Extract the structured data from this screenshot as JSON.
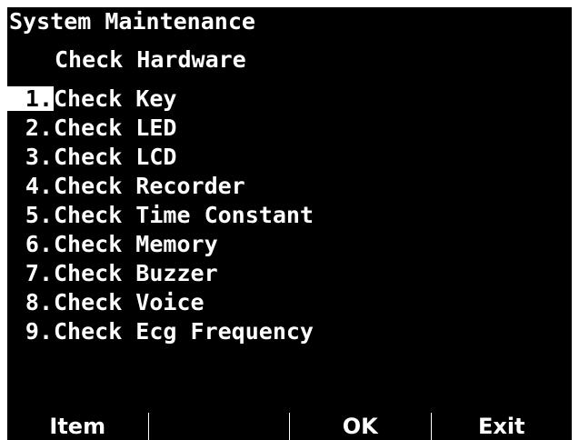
{
  "screen": {
    "title": "System Maintenance",
    "subtitle": "Check Hardware"
  },
  "menu": {
    "selected_index": 0,
    "items": [
      {
        "num": "1.",
        "label": "Check Key"
      },
      {
        "num": "2.",
        "label": "Check LED"
      },
      {
        "num": "3.",
        "label": "Check LCD"
      },
      {
        "num": "4.",
        "label": "Check Recorder"
      },
      {
        "num": "5.",
        "label": "Check Time Constant"
      },
      {
        "num": "6.",
        "label": "Check Memory"
      },
      {
        "num": "7.",
        "label": "Check Buzzer"
      },
      {
        "num": "8.",
        "label": "Check Voice"
      },
      {
        "num": "9.",
        "label": "Check Ecg Frequency"
      }
    ]
  },
  "softkeys": {
    "f1": "Item",
    "f2": "",
    "f3": "OK",
    "f4": "Exit"
  },
  "colors": {
    "background": "#000000",
    "text": "#ffffff",
    "highlight": "#ffffff"
  }
}
